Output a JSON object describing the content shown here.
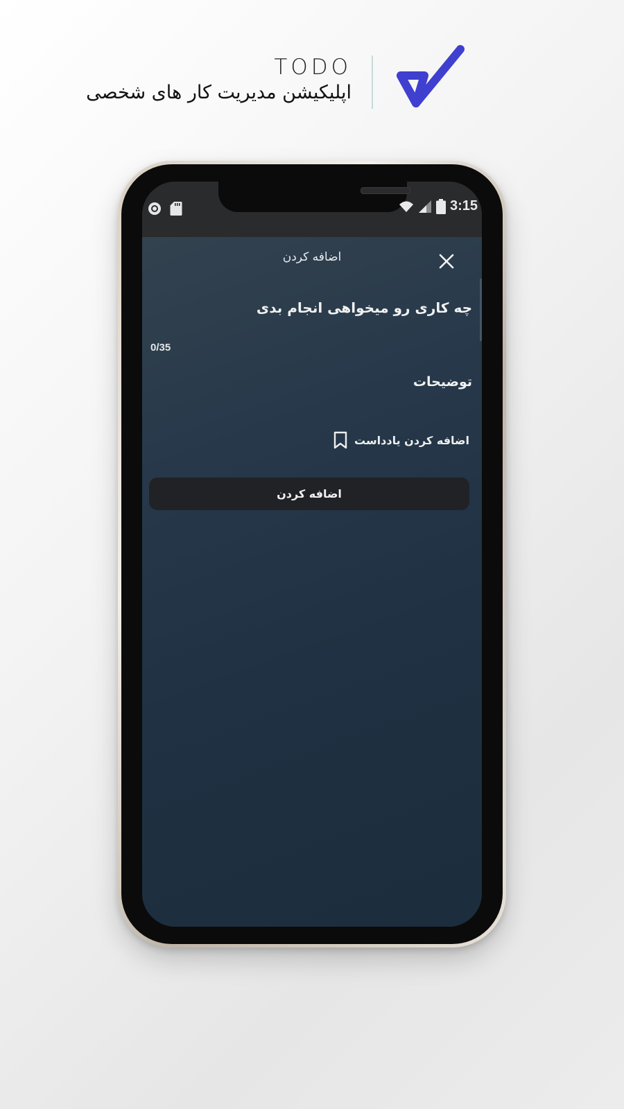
{
  "brand": {
    "title": "TODO",
    "subtitle": "اپلیکیشن مدیریت کار های شخصی",
    "logo_icon": "double-check-icon",
    "logo_color": "#3f3fd0"
  },
  "status_bar": {
    "time": "3:15",
    "left_icons": [
      "record-icon",
      "sd-card-icon"
    ],
    "right_icons": [
      "wifi-icon",
      "signal-icon",
      "battery-icon"
    ]
  },
  "dialog": {
    "title": "اضافه کردن",
    "close_icon": "close-icon",
    "task_placeholder": "چه کاری رو میخواهی انجام بدی",
    "char_counter": "0/35",
    "description_placeholder": "توضیحات",
    "add_note_label": "اضافه کردن یادداست",
    "add_note_icon": "bookmark-icon",
    "submit_label": "اضافه کردن"
  },
  "colors": {
    "app_background": "#1f3142",
    "button_background": "#202226",
    "status_bar_background": "#2a2b2d"
  }
}
